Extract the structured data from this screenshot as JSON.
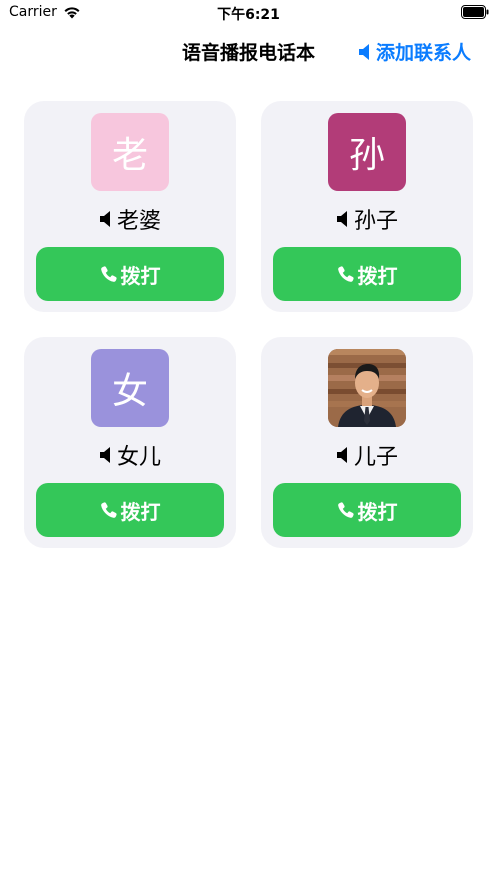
{
  "status_bar": {
    "carrier": "Carrier",
    "time": "下午6:21"
  },
  "nav": {
    "title": "语音播报电话本",
    "add_contact_label": "添加联系人",
    "accent_color": "#0a7cff"
  },
  "contacts": [
    {
      "avatar_char": "老",
      "avatar_color": "#f7c6dd",
      "name": "老婆",
      "call_label": "拨打"
    },
    {
      "avatar_char": "孙",
      "avatar_color": "#b23c78",
      "name": "孙子",
      "call_label": "拨打"
    },
    {
      "avatar_char": "女",
      "avatar_color": "#9a92dc",
      "name": "女儿",
      "call_label": "拨打"
    },
    {
      "avatar_char": "",
      "avatar_color": "photo",
      "name": "儿子",
      "call_label": "拨打"
    }
  ],
  "colors": {
    "call_button": "#34c759",
    "card_background": "#f2f2f7"
  },
  "icons": [
    "wifi-icon",
    "battery-icon",
    "speaker-icon",
    "phone-icon"
  ]
}
